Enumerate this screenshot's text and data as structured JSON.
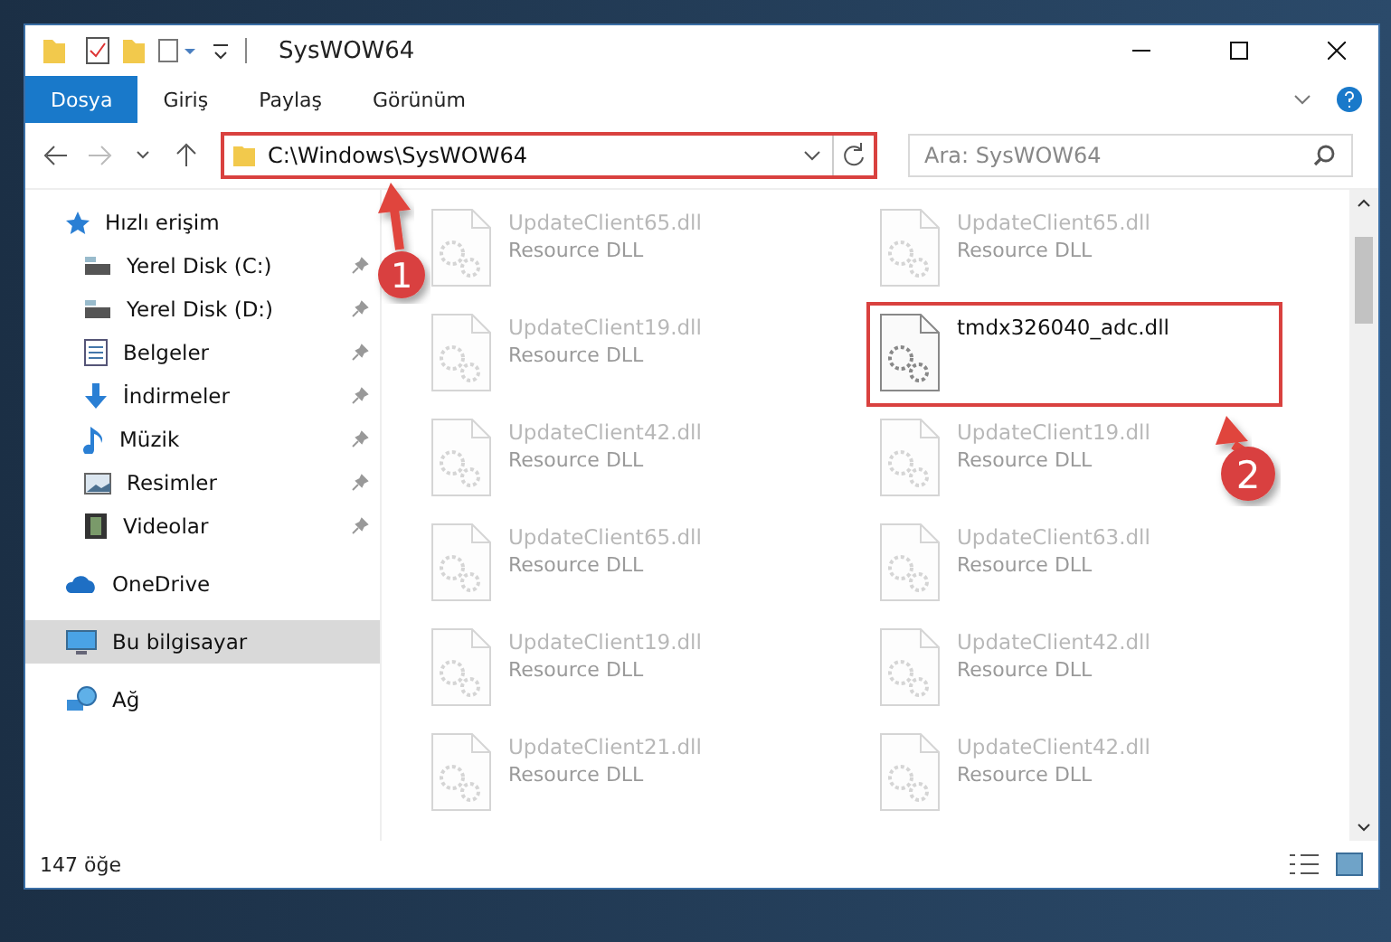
{
  "window": {
    "title": "SysWOW64"
  },
  "ribbon_tabs": [
    {
      "label": "Dosya",
      "selected": true
    },
    {
      "label": "Giriş",
      "selected": false
    },
    {
      "label": "Paylaş",
      "selected": false
    },
    {
      "label": "Görünüm",
      "selected": false
    }
  ],
  "address": {
    "path": "C:\\Windows\\SysWOW64"
  },
  "search": {
    "placeholder": "Ara: SysWOW64"
  },
  "nav": [
    {
      "label": "Hızlı erişim",
      "kind": "star",
      "selected": false,
      "children": [
        {
          "label": "Yerel Disk (C:)",
          "kind": "drive",
          "pinned": true,
          "selected": false
        },
        {
          "label": "Yerel Disk (D:)",
          "kind": "drive",
          "pinned": true,
          "selected": false
        },
        {
          "label": "Belgeler",
          "kind": "docs",
          "pinned": true,
          "selected": false
        },
        {
          "label": "İndirmeler",
          "kind": "download",
          "pinned": true,
          "selected": false
        },
        {
          "label": "Müzik",
          "kind": "music",
          "pinned": true,
          "selected": false
        },
        {
          "label": "Resimler",
          "kind": "pictures",
          "pinned": true,
          "selected": false
        },
        {
          "label": "Videolar",
          "kind": "video",
          "pinned": true,
          "selected": false
        }
      ]
    },
    {
      "label": "OneDrive",
      "kind": "cloud",
      "selected": false
    },
    {
      "label": "Bu bilgisayar",
      "kind": "pc",
      "selected": true
    },
    {
      "label": "Ağ",
      "kind": "network",
      "selected": false
    }
  ],
  "files": [
    {
      "name": "UpdateClient65.dll",
      "type": "Resource DLL",
      "faded": true,
      "highlighted": false
    },
    {
      "name": "UpdateClient65.dll",
      "type": "Resource DLL",
      "faded": true,
      "highlighted": false
    },
    {
      "name": "UpdateClient19.dll",
      "type": "Resource DLL",
      "faded": true,
      "highlighted": false
    },
    {
      "name": "tmdx326040_adc.dll",
      "faded": false,
      "highlighted": true
    },
    {
      "name": "UpdateClient42.dll",
      "type": "Resource DLL",
      "faded": true,
      "highlighted": false
    },
    {
      "name": "UpdateClient19.dll",
      "type": "Resource DLL",
      "faded": true,
      "highlighted": false
    },
    {
      "name": "UpdateClient65.dll",
      "type": "Resource DLL",
      "faded": true,
      "highlighted": false
    },
    {
      "name": "UpdateClient63.dll",
      "type": "Resource DLL",
      "faded": true,
      "highlighted": false
    },
    {
      "name": "UpdateClient19.dll",
      "type": "Resource DLL",
      "faded": true,
      "highlighted": false
    },
    {
      "name": "UpdateClient42.dll",
      "type": "Resource DLL",
      "faded": true,
      "highlighted": false
    },
    {
      "name": "UpdateClient21.dll",
      "type": "Resource DLL",
      "faded": true,
      "highlighted": false
    },
    {
      "name": "UpdateClient42.dll",
      "type": "Resource DLL",
      "faded": true,
      "highlighted": false
    }
  ],
  "status_bar": {
    "count": "147 öğe"
  },
  "annotations": [
    {
      "number": "1"
    },
    {
      "number": "2"
    }
  ]
}
